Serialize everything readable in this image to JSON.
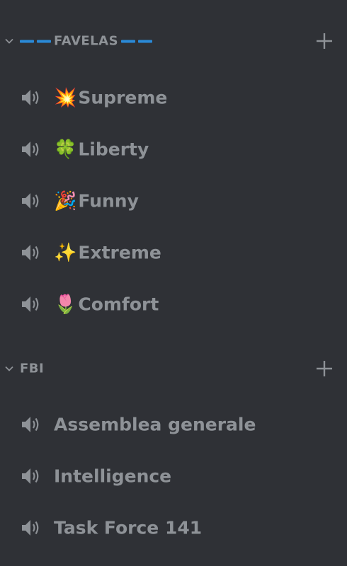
{
  "categories": [
    {
      "name": "FAVELAS",
      "decorated": true,
      "channels": [
        {
          "emoji": "💥",
          "name": "Supreme"
        },
        {
          "emoji": "🍀",
          "name": "Liberty"
        },
        {
          "emoji": "🎉",
          "name": "Funny"
        },
        {
          "emoji": "✨",
          "name": "Extreme"
        },
        {
          "emoji": "🌷",
          "name": "Comfort"
        }
      ]
    },
    {
      "name": "FBI",
      "decorated": false,
      "channels": [
        {
          "emoji": "",
          "name": "Assemblea generale"
        },
        {
          "emoji": "",
          "name": "Intelligence"
        },
        {
          "emoji": "",
          "name": "Task Force 141"
        }
      ]
    }
  ],
  "colors": {
    "background": "#2f3136",
    "text_muted": "#8e9297",
    "accent_dash": "#2a8ad8"
  },
  "icons": {
    "collapse": "chevron-down-icon",
    "add": "plus-icon",
    "voice": "speaker-icon"
  }
}
